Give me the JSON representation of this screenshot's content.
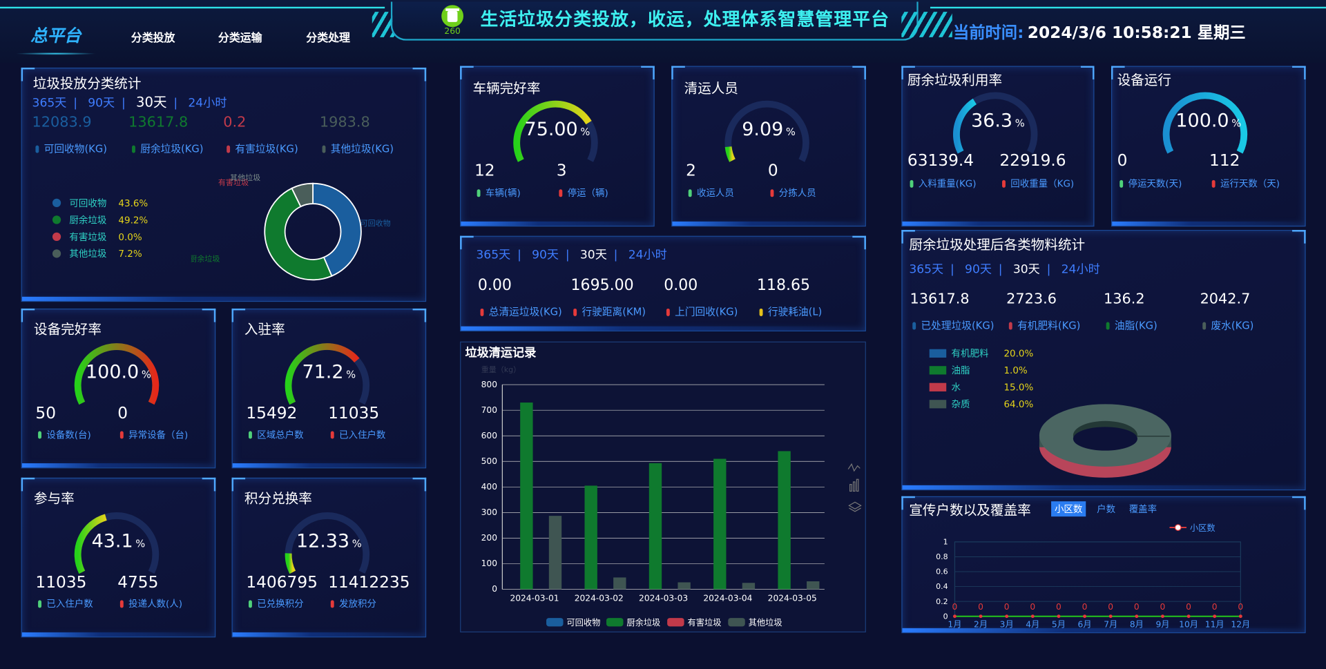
{
  "header": {
    "nav_main": "总平台",
    "nav_items": [
      "分类投放",
      "分类运输",
      "分类处理"
    ],
    "logo_number": "260",
    "title": "生活垃圾分类投放，收运，处理体系智慧管理平台",
    "time_label": "当前时间:",
    "time_value": "2024/3/6 10:58:21 星期三"
  },
  "colors": {
    "recyclable": "#1a5e9e",
    "kitchen": "#0f7a2e",
    "hazardous": "#c23a4a",
    "other": "#4a5e5a",
    "accent": "#3ef0f0",
    "label": "#4a9aff"
  },
  "drop_stats": {
    "title": "垃圾投放分类统计",
    "tabs": [
      "365天",
      "90天",
      "30天",
      "24小时"
    ],
    "active_tab": "30天",
    "values": [
      {
        "value": "12083.9",
        "label": "可回收物(KG)",
        "color": "#1a5e9e"
      },
      {
        "value": "13617.8",
        "label": "厨余垃圾(KG)",
        "color": "#0f7a2e"
      },
      {
        "value": "0.2",
        "label": "有害垃圾(KG)",
        "color": "#c23a4a"
      },
      {
        "value": "1983.8",
        "label": "其他垃圾(KG)",
        "color": "#4a5e5a"
      }
    ],
    "legend": [
      {
        "name": "可回收物",
        "pct": "43.6%",
        "color": "#1a5e9e"
      },
      {
        "name": "厨余垃圾",
        "pct": "49.2%",
        "color": "#0f7a2e"
      },
      {
        "name": "有害垃圾",
        "pct": "0.0%",
        "color": "#c23a4a"
      },
      {
        "name": "其他垃圾",
        "pct": "7.2%",
        "color": "#4a5e5a"
      }
    ],
    "pie_labels": {
      "recyclable": "可回收物",
      "kitchen": "厨余垃圾",
      "hazardous": "有害垃圾",
      "other": "其他垃圾"
    }
  },
  "device_ok": {
    "title": "设备完好率",
    "gauge": "100.0",
    "unit": "%",
    "fraction": 1.0,
    "n1": "50",
    "l1": "设备数(台)",
    "n2": "0",
    "l2": "异常设备（台)"
  },
  "occupancy": {
    "title": "入驻率",
    "gauge": "71.2",
    "unit": "%",
    "fraction": 0.712,
    "n1": "15492",
    "l1": "区域总户数",
    "n2": "11035",
    "l2": "已入住户数"
  },
  "participation": {
    "title": "参与率",
    "gauge": "43.1",
    "unit": "%",
    "fraction": 0.431,
    "n1": "11035",
    "l1": "已入住户数",
    "n2": "4755",
    "l2": "投递人数(人)"
  },
  "points": {
    "title": "积分兑换率",
    "gauge": "12.33",
    "unit": "%",
    "fraction": 0.1233,
    "n1": "1406795",
    "l1": "已兑换积分",
    "n2": "11412235",
    "l2": "发放积分"
  },
  "vehicle": {
    "title": "车辆完好率",
    "gauge": "75.00",
    "unit": "%",
    "fraction": 0.75,
    "n1": "12",
    "l1": "车辆(辆)",
    "n2": "3",
    "l2": "停运（辆)"
  },
  "cleaners": {
    "title": "清运人员",
    "gauge": "9.09",
    "unit": "%",
    "fraction": 0.0909,
    "n1": "2",
    "l1": "收运人员",
    "n2": "0",
    "l2": "分拣人员"
  },
  "transport": {
    "tabs": [
      "365天",
      "90天",
      "30天",
      "24小时"
    ],
    "active_tab": "30天",
    "values": [
      {
        "value": "0.00",
        "label": "总清运垃圾(KG)",
        "color": "#e53a3a"
      },
      {
        "value": "1695.00",
        "label": "行驶距离(KM)",
        "color": "#e53a3a"
      },
      {
        "value": "0.00",
        "label": "上门回收(KG)",
        "color": "#e53a3a"
      },
      {
        "value": "118.65",
        "label": "行驶耗油(L)",
        "color": "#e5c21a"
      }
    ]
  },
  "kitchen_util": {
    "title": "厨余垃圾利用率",
    "gauge": "36.3",
    "unit": "%",
    "fraction": 0.363,
    "n1": "63139.4",
    "l1": "入料重量(KG)",
    "n2": "22919.6",
    "l2": "回收重量（KG)"
  },
  "device_run": {
    "title": "设备运行",
    "gauge": "100.0",
    "unit": "%",
    "fraction": 1.0,
    "n1": "0",
    "l1": "停运天数(天)",
    "n2": "112",
    "l2": "运行天数（天)"
  },
  "kitchen_materials": {
    "title": "厨余垃圾处理后各类物料统计",
    "tabs": [
      "365天",
      "90天",
      "30天",
      "24小时"
    ],
    "active_tab": "30天",
    "values": [
      {
        "value": "13617.8",
        "label": "已处理垃圾(KG)",
        "color": "#1a5e9e"
      },
      {
        "value": "2723.6",
        "label": "有机肥料(KG)",
        "color": "#c23a4a"
      },
      {
        "value": "136.2",
        "label": "油脂(KG)",
        "color": "#0f7a2e"
      },
      {
        "value": "2042.7",
        "label": "废水(KG)",
        "color": "#4a5e5a"
      }
    ],
    "legend": [
      {
        "name": "有机肥料",
        "pct": "20.0%",
        "color": "#1a5e9e"
      },
      {
        "name": "油脂",
        "pct": "1.0%",
        "color": "#0f7a2e"
      },
      {
        "name": "水",
        "pct": "15.0%",
        "color": "#c23a4a"
      },
      {
        "name": "杂质",
        "pct": "64.0%",
        "color": "#3f5552"
      }
    ]
  },
  "clean_record": {
    "title": "垃圾清运记录",
    "unit_label": "重量（kg）",
    "legend": [
      "可回收物",
      "厨余垃圾",
      "有害垃圾",
      "其他垃圾"
    ]
  },
  "promotion": {
    "title": "宣传户数以及覆盖率",
    "tabs": [
      "小区数",
      "户数",
      "覆盖率"
    ],
    "active_tab": "小区数",
    "legend": "小区数"
  },
  "chart_data": [
    {
      "type": "bar",
      "title": "垃圾清运记录",
      "ylabel": "重量（kg）",
      "categories": [
        "2024-03-01",
        "2024-03-02",
        "2024-03-03",
        "2024-03-04",
        "2024-03-05"
      ],
      "ylim": [
        0,
        800
      ],
      "yticks": [
        0,
        100,
        200,
        300,
        400,
        500,
        600,
        700,
        800
      ],
      "series": [
        {
          "name": "可回收物",
          "values": [
            0,
            0,
            0,
            0,
            0
          ],
          "color": "#1a5e9e"
        },
        {
          "name": "厨余垃圾",
          "values": [
            730,
            405,
            493,
            510,
            540
          ],
          "color": "#0f7a2e"
        },
        {
          "name": "有害垃圾",
          "values": [
            0,
            0,
            0,
            0,
            0
          ],
          "color": "#c23a4a"
        },
        {
          "name": "其他垃圾",
          "values": [
            287,
            46,
            27,
            25,
            31
          ],
          "color": "#3f5552"
        }
      ],
      "grid": true,
      "legend_position": "bottom"
    },
    {
      "type": "line",
      "categories": [
        "1月",
        "2月",
        "3月",
        "4月",
        "5月",
        "6月",
        "7月",
        "8月",
        "9月",
        "10月",
        "11月",
        "12月"
      ],
      "ylim": [
        0,
        1
      ],
      "yticks": [
        "0",
        "0.2",
        "0.4",
        "0.6",
        "0.8",
        "1"
      ],
      "series": [
        {
          "name": "小区数",
          "values": [
            0,
            0,
            0,
            0,
            0,
            0,
            0,
            0,
            0,
            0,
            0,
            0
          ],
          "color": "#e53a3a"
        }
      ],
      "legend_position": "top-right"
    },
    {
      "type": "pie",
      "labels": [
        "可回收物",
        "厨余垃圾",
        "有害垃圾",
        "其他垃圾"
      ],
      "values": [
        43.6,
        49.2,
        0.0,
        7.2
      ]
    },
    {
      "type": "pie",
      "labels": [
        "有机肥料",
        "油脂",
        "水",
        "杂质"
      ],
      "values": [
        20.0,
        1.0,
        15.0,
        64.0
      ]
    }
  ]
}
